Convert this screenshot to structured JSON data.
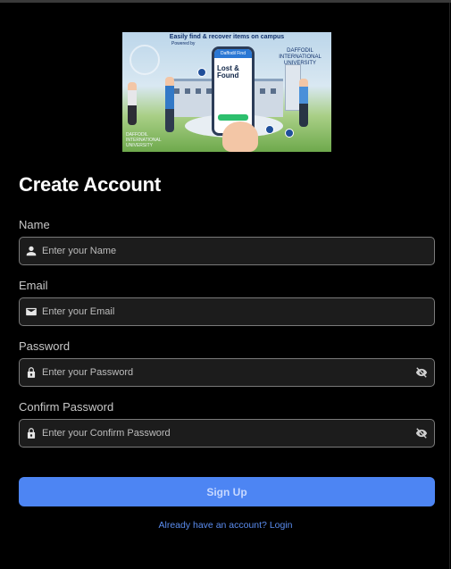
{
  "banner": {
    "caption": "Easily find & recover items on campus",
    "subcaption": "Powered by",
    "phone_header": "Daffodil Find",
    "phone_title_line1": "Lost &",
    "phone_title_line2": "Found",
    "university_right": "DAFFODIL INTERNATIONAL UNIVERSITY",
    "university_left": "DAFFODIL INTERNATIONAL UNIVERSITY"
  },
  "page_title": "Create Account",
  "form": {
    "name": {
      "label": "Name",
      "placeholder": "Enter your Name",
      "value": ""
    },
    "email": {
      "label": "Email",
      "placeholder": "Enter your Email",
      "value": ""
    },
    "password": {
      "label": "Password",
      "placeholder": "Enter your Password",
      "value": ""
    },
    "confirm": {
      "label": "Confirm Password",
      "placeholder": "Enter your Confirm Password",
      "value": ""
    }
  },
  "signup_label": "Sign Up",
  "login_link": "Already have an account? Login",
  "icons": {
    "name": "person-icon",
    "email": "mail-icon",
    "password": "lock-icon",
    "visibility": "eye-off-icon"
  },
  "colors": {
    "background": "#000000",
    "field_bg": "#1c1c1c",
    "field_border": "#7a7a7a",
    "accent": "#4d85f3",
    "link": "#5b8df0"
  }
}
